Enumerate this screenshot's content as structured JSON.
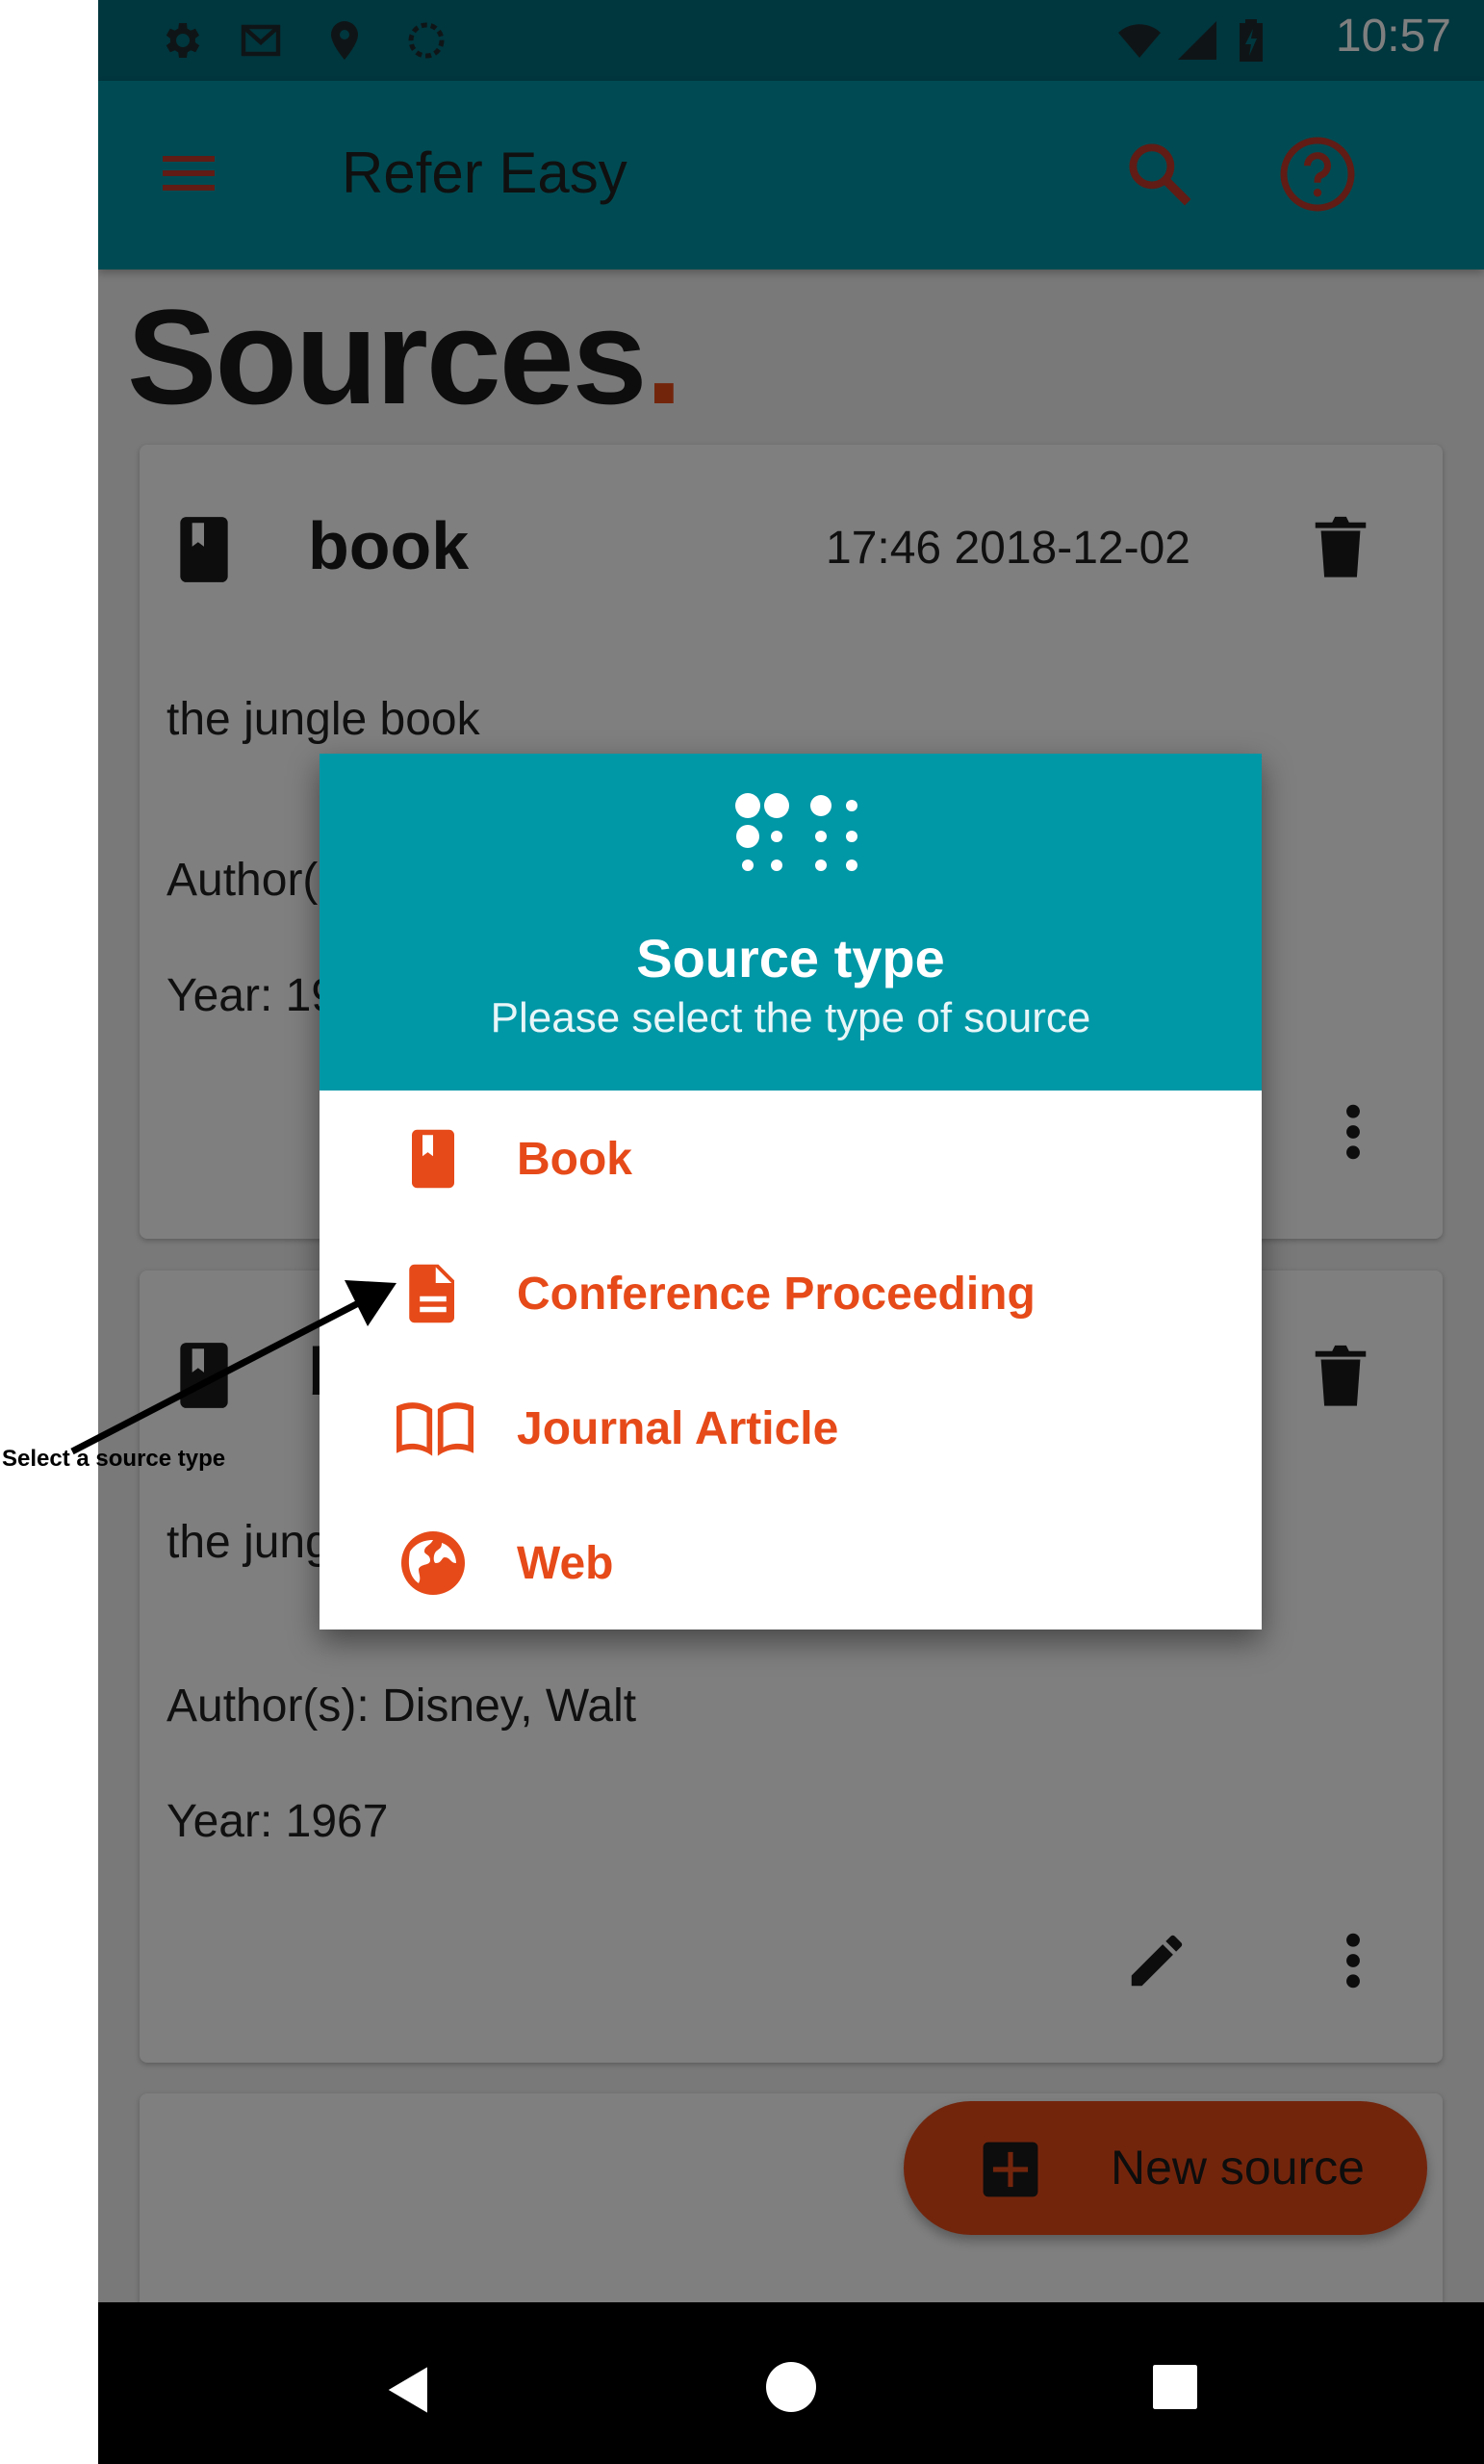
{
  "status_bar": {
    "time": "10:57"
  },
  "app_bar": {
    "title": "Refer Easy"
  },
  "page": {
    "title": "Sources",
    "title_dot": "."
  },
  "cards": [
    {
      "title": "book",
      "timestamp": "17:46 2018-12-02",
      "name": "the jungle book",
      "authors_partial": "Author(",
      "year_partial": "Year: 19"
    },
    {
      "title_partial": "b",
      "name_partial": "the jung",
      "authors": "Author(s): Disney, Walt",
      "year": "Year: 1967"
    }
  ],
  "fab": {
    "label": "New source"
  },
  "dialog": {
    "title": "Source type",
    "subtitle": "Please select the type of source",
    "options": [
      {
        "label": "Book",
        "icon": "book-icon"
      },
      {
        "label": "Conference Proceeding",
        "icon": "document-icon"
      },
      {
        "label": "Journal Article",
        "icon": "open-book-icon"
      },
      {
        "label": "Web",
        "icon": "globe-icon"
      }
    ]
  },
  "annotation": {
    "text": "Select a source type"
  },
  "colors": {
    "primary": "#0097a7",
    "primary_dark": "#006c7d",
    "accent": "#e64a19",
    "scrim": "rgba(0,0,0,0.5)"
  }
}
